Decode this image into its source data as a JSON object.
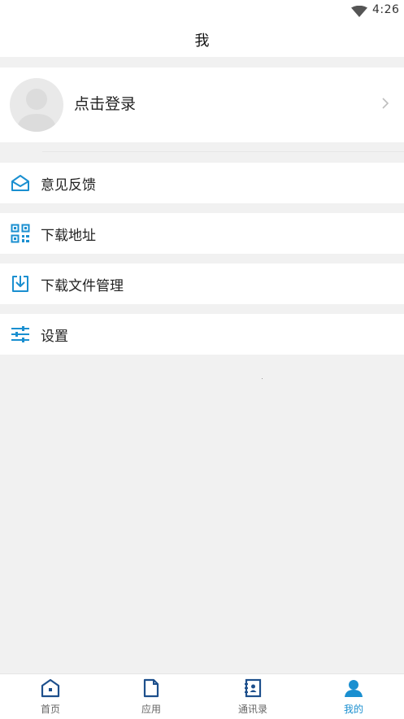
{
  "status_bar": {
    "time": "4:26",
    "wifi_icon": "wifi-icon"
  },
  "header": {
    "title": "我"
  },
  "profile": {
    "login_label": "点击登录",
    "avatar_icon": "avatar-placeholder-icon",
    "chevron_icon": "chevron-right-icon"
  },
  "menu": {
    "items": [
      {
        "label": "意见反馈",
        "icon": "mail-open-icon"
      },
      {
        "label": "下载地址",
        "icon": "qr-code-icon"
      },
      {
        "label": "下载文件管理",
        "icon": "download-tray-icon"
      },
      {
        "label": "设置",
        "icon": "sliders-icon"
      }
    ]
  },
  "tab_bar": {
    "tabs": [
      {
        "label": "首页",
        "icon": "home-icon",
        "active": false
      },
      {
        "label": "应用",
        "icon": "document-icon",
        "active": false
      },
      {
        "label": "通讯录",
        "icon": "contacts-book-icon",
        "active": false
      },
      {
        "label": "我的",
        "icon": "person-icon",
        "active": true
      }
    ]
  },
  "colors": {
    "accent": "#1a8fd0",
    "nav_icon": "#1d4f8c",
    "background": "#f1f1f1"
  }
}
